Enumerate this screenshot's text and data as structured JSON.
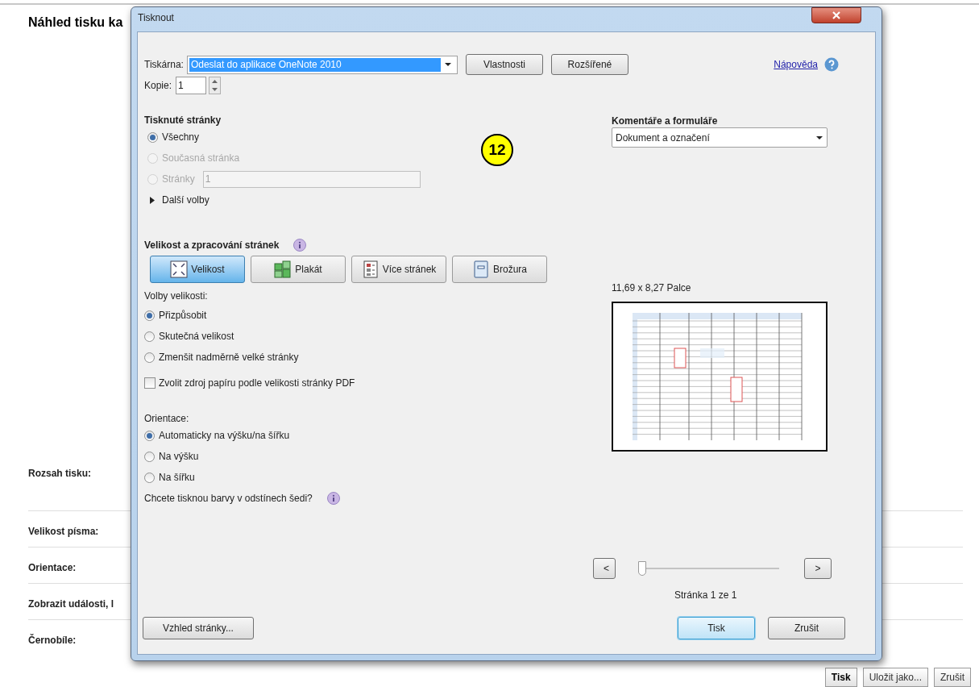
{
  "background_page": {
    "title": "Náhled tisku ka",
    "settings": [
      {
        "label": "Rozsah tisku:"
      },
      {
        "label": "Velikost písma:"
      },
      {
        "label": "Orientace:"
      },
      {
        "label": "Zobrazit události, l"
      },
      {
        "label": "Černobíle:"
      }
    ],
    "buttons": [
      {
        "label": "Tisk",
        "default": true
      },
      {
        "label": "Uložit jako...",
        "default": false
      },
      {
        "label": "Zrušit",
        "default": false
      }
    ]
  },
  "callout": "12",
  "dialog": {
    "title": "Tisknout",
    "printer": {
      "label": "Tiskárna:",
      "value": "Odeslat do aplikace OneNote 2010",
      "buttons": [
        "Vlastnosti",
        "Rozšířené"
      ]
    },
    "help_link": "Nápověda",
    "copies": {
      "label": "Kopie:",
      "value": "1"
    },
    "pages": {
      "title": "Tisknuté stránky",
      "options": [
        {
          "label": "Všechny",
          "selected": true,
          "disabled": false
        },
        {
          "label": "Současná stránka",
          "selected": false,
          "disabled": true
        },
        {
          "label": "Stránky",
          "selected": false,
          "disabled": true,
          "kind": "range",
          "value": "1"
        }
      ],
      "more": {
        "label": "Další volby",
        "expanded": false
      }
    },
    "sizing": {
      "title": "Velikost a zpracování stránek",
      "modes": [
        {
          "label": "Velikost",
          "selected": true,
          "kind": "size"
        },
        {
          "label": "Plakát",
          "selected": false,
          "kind": "poster"
        },
        {
          "label": "Více stránek",
          "selected": false,
          "kind": "multiple"
        },
        {
          "label": "Brožura",
          "selected": false,
          "kind": "booklet"
        }
      ],
      "options_label": "Volby velikosti:",
      "options": [
        {
          "label": "Přizpůsobit",
          "selected": true
        },
        {
          "label": "Skutečná velikost",
          "selected": false
        },
        {
          "label": "Zmenšit nadměrně velké stránky",
          "selected": false
        }
      ],
      "paper_source": {
        "label": "Zvolit zdroj papíru podle velikosti stránky PDF",
        "checked": false
      }
    },
    "orientation": {
      "title": "Orientace:",
      "options": [
        {
          "label": "Automaticky na výšku/na šířku",
          "selected": true
        },
        {
          "label": "Na výšku",
          "selected": false
        },
        {
          "label": "Na šířku",
          "selected": false
        }
      ]
    },
    "grayscale_question": "Chcete tisknou barvy v odstínech šedi?",
    "comments": {
      "title": "Komentáře a formuláře",
      "value": "Dokument a označení"
    },
    "preview": {
      "size": "11,69 x 8,27 Palce",
      "prev": "<",
      "next": ">",
      "slider": {
        "level": 0
      },
      "page_label": "Stránka 1 ze 1"
    },
    "page_setup_button": "Vzhled stránky...",
    "buttons": [
      {
        "label": "Tisk",
        "default": true
      },
      {
        "label": "Zrušit",
        "default": false
      }
    ]
  }
}
